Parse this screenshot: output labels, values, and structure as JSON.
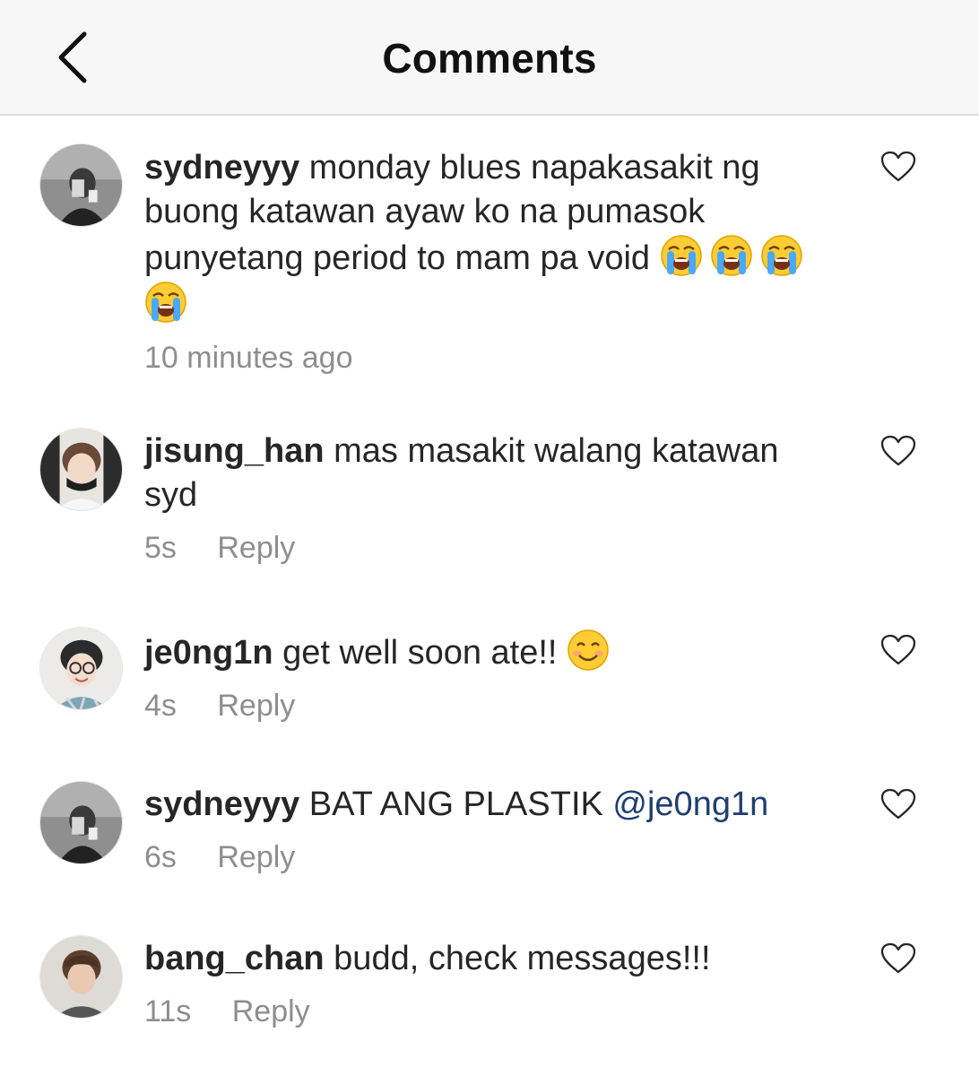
{
  "header": {
    "title": "Comments"
  },
  "comments": [
    {
      "username": "sydneyyy",
      "text": "monday blues napakasakit ng buong katawan ayaw ko na pumasok punyetang period to mam pa void",
      "time": "10 minutes ago"
    },
    {
      "username": "jisung_han",
      "text": "mas masakit walang katawan syd",
      "time": "5s",
      "reply": "Reply"
    },
    {
      "username": "je0ng1n",
      "text": "get well soon ate!!",
      "time": "4s",
      "reply": "Reply"
    },
    {
      "username": "sydneyyy",
      "text": "BAT ANG PLASTIK",
      "mention": "@je0ng1n",
      "time": "6s",
      "reply": "Reply"
    },
    {
      "username": "bang_chan",
      "text": "budd, check messages!!!",
      "time": "11s",
      "reply": "Reply"
    }
  ],
  "icons": {
    "back": "chevron-left-icon",
    "like": "heart-outline-icon",
    "crying_emoji": "loudly-crying-face",
    "smile_emoji": "smiling-face"
  }
}
